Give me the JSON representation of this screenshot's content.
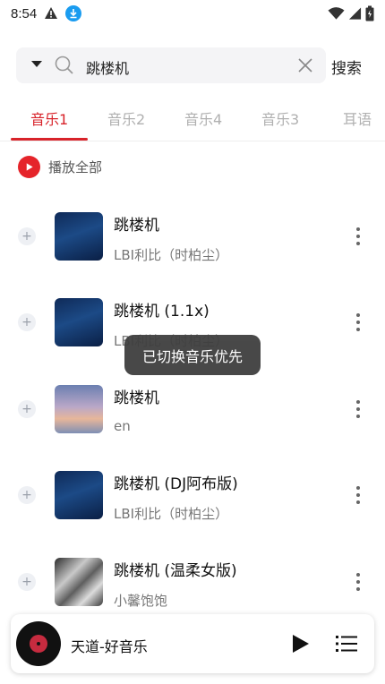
{
  "status_bar": {
    "time": "8:54"
  },
  "search": {
    "query": "跳楼机",
    "button_label": "搜索"
  },
  "tabs": [
    {
      "label": "音乐1",
      "active": true
    },
    {
      "label": "音乐2",
      "active": false
    },
    {
      "label": "音乐4",
      "active": false
    },
    {
      "label": "音乐3",
      "active": false
    },
    {
      "label": "耳语",
      "active": false
    }
  ],
  "play_all": {
    "label": "播放全部"
  },
  "songs": [
    {
      "title": "跳楼机",
      "artist": "LBI利比（时柏尘）",
      "cover": "cover-a"
    },
    {
      "title": "跳楼机 (1.1x)",
      "artist": "LBI利比（时柏尘）",
      "cover": "cover-a"
    },
    {
      "title": "跳楼机",
      "artist": "en",
      "cover": "cover-b"
    },
    {
      "title": "跳楼机 (DJ阿布版)",
      "artist": "LBI利比（时柏尘）",
      "cover": "cover-a"
    },
    {
      "title": "跳楼机 (温柔女版)",
      "artist": "小馨饱饱",
      "cover": "cover-c"
    }
  ],
  "toast": {
    "message": "已切换音乐优先"
  },
  "player": {
    "now_playing": "天道-好音乐"
  },
  "colors": {
    "accent": "#d8232a",
    "download_badge": "#1a9cf0",
    "toast_bg": "#3f3f3f"
  }
}
